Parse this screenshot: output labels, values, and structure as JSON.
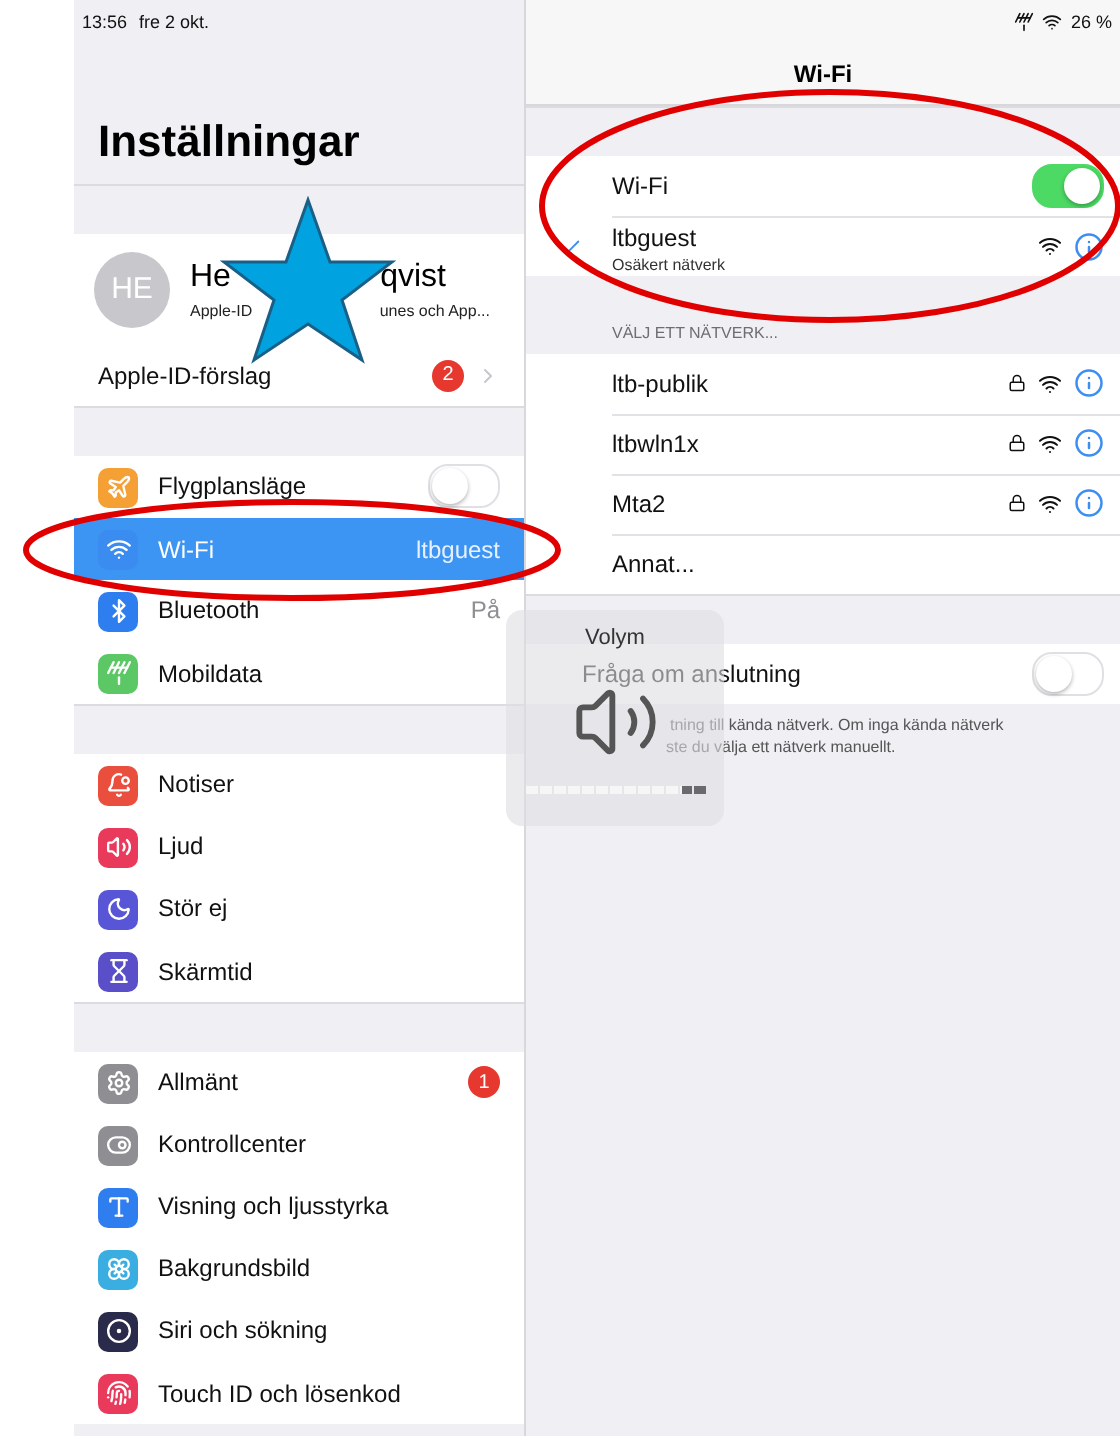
{
  "status_bar": {
    "time": "13:56",
    "date": "fre 2 okt.",
    "battery": "26 %"
  },
  "sidebar": {
    "title": "Inställningar",
    "profile": {
      "initials": "HE",
      "name_parts": [
        "He",
        "qvist"
      ],
      "subtitle_parts": [
        "Apple-ID",
        "unes och App..."
      ]
    },
    "suggestion": {
      "label": "Apple-ID-förslag",
      "badge": "2"
    },
    "groups": [
      [
        {
          "label": "Flygplansläge",
          "kind": "toggle",
          "on": false,
          "selected": false,
          "color": "#f4a035"
        },
        {
          "label": "Wi-Fi",
          "kind": "value",
          "value": "ltbguest",
          "selected": true,
          "color": "#3a8cf0"
        },
        {
          "label": "Bluetooth",
          "kind": "value",
          "value": "På",
          "selected": false,
          "color": "#2f7ef0"
        },
        {
          "label": "Mobildata",
          "kind": "plain",
          "selected": false,
          "color": "#5cc865"
        }
      ],
      [
        {
          "label": "Notiser",
          "kind": "plain",
          "selected": false,
          "color": "#ea4e3d"
        },
        {
          "label": "Ljud",
          "kind": "plain",
          "selected": false,
          "color": "#ea3a5c"
        },
        {
          "label": "Stör ej",
          "kind": "plain",
          "selected": false,
          "color": "#5856d6"
        },
        {
          "label": "Skärmtid",
          "kind": "plain",
          "selected": false,
          "color": "#5a4fc8"
        }
      ],
      [
        {
          "label": "Allmänt",
          "kind": "badge",
          "badge": "1",
          "selected": false,
          "color": "#8e8e93"
        },
        {
          "label": "Kontrollcenter",
          "kind": "plain",
          "selected": false,
          "color": "#8e8e93"
        },
        {
          "label": "Visning och ljusstyrka",
          "kind": "plain",
          "selected": false,
          "color": "#2f7ef0"
        },
        {
          "label": "Bakgrundsbild",
          "kind": "plain",
          "selected": false,
          "color": "#3aaee0"
        },
        {
          "label": "Siri och sökning",
          "kind": "plain",
          "selected": false,
          "color": "#2a2a4a"
        },
        {
          "label": "Touch ID och lösenkod",
          "kind": "plain",
          "selected": false,
          "color": "#ea3a5c"
        }
      ]
    ]
  },
  "detail": {
    "title": "Wi-Fi",
    "wifi_toggle": {
      "label": "Wi-Fi",
      "on": true
    },
    "connected": {
      "name": "ltbguest",
      "status": "Osäkert nätverk",
      "checked": true
    },
    "section_header": "VÄLJ ETT NÄTVERK...",
    "networks": [
      {
        "name": "ltb-publik",
        "locked": true
      },
      {
        "name": "ltbwln1x",
        "locked": true
      },
      {
        "name": "Mta2",
        "locked": true
      }
    ],
    "other": "Annat...",
    "ask_join": {
      "label": "Fråga om anslutning",
      "on": false
    },
    "footer_lines": [
      "tning till kända nätverk. Om inga kända nätverk",
      "ste du välja ett nätverk manuellt."
    ]
  },
  "volume_hud": {
    "title": "Volym",
    "level": 0.87
  }
}
